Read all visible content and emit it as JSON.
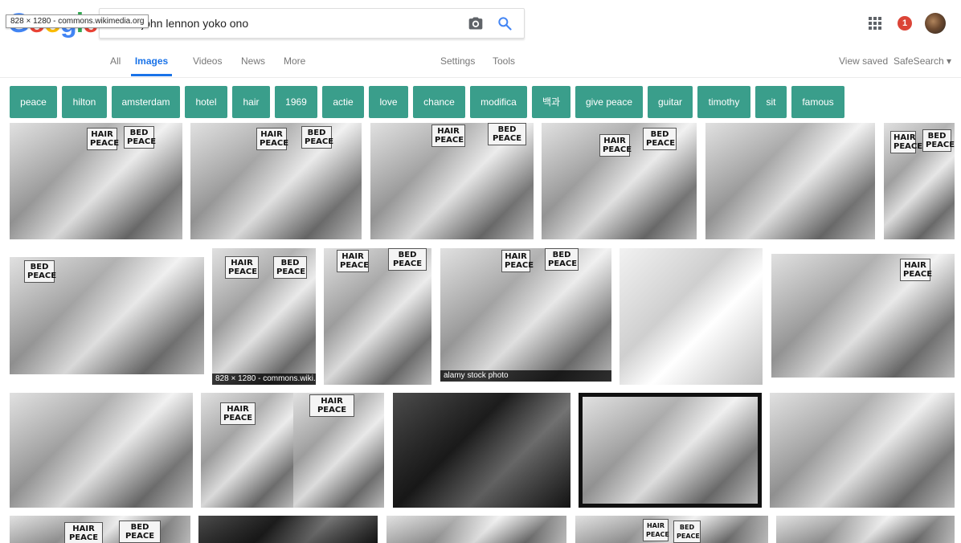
{
  "header": {
    "logo_letters": [
      "G",
      "o",
      "o",
      "g",
      "l",
      "e"
    ],
    "tooltip": "828 × 1280 - commons.wikimedia.org",
    "search_value": "john lennon yoko ono",
    "notification_count": "1"
  },
  "nav": {
    "tabs": [
      "All",
      "Images",
      "Videos",
      "News",
      "More"
    ],
    "settings": "Settings",
    "tools": "Tools",
    "view_saved": "View saved",
    "safesearch": "SafeSearch ▾"
  },
  "chips": [
    "peace",
    "hilton",
    "amsterdam",
    "hotel",
    "hair",
    "1969",
    "actie",
    "love",
    "chance",
    "modifica",
    "백과",
    "give peace",
    "guitar",
    "timothy",
    "sit",
    "famous"
  ],
  "signs": {
    "hair": "HAIR PEACE",
    "bed": "BED PEACE"
  },
  "captions": {
    "wiki": "828 × 1280 - commons.wiki...",
    "alamy": "alamy stock photo"
  },
  "colors": {
    "chip_bg": "#3a9e8b",
    "accent": "#1a73e8",
    "notification": "#db4437"
  }
}
